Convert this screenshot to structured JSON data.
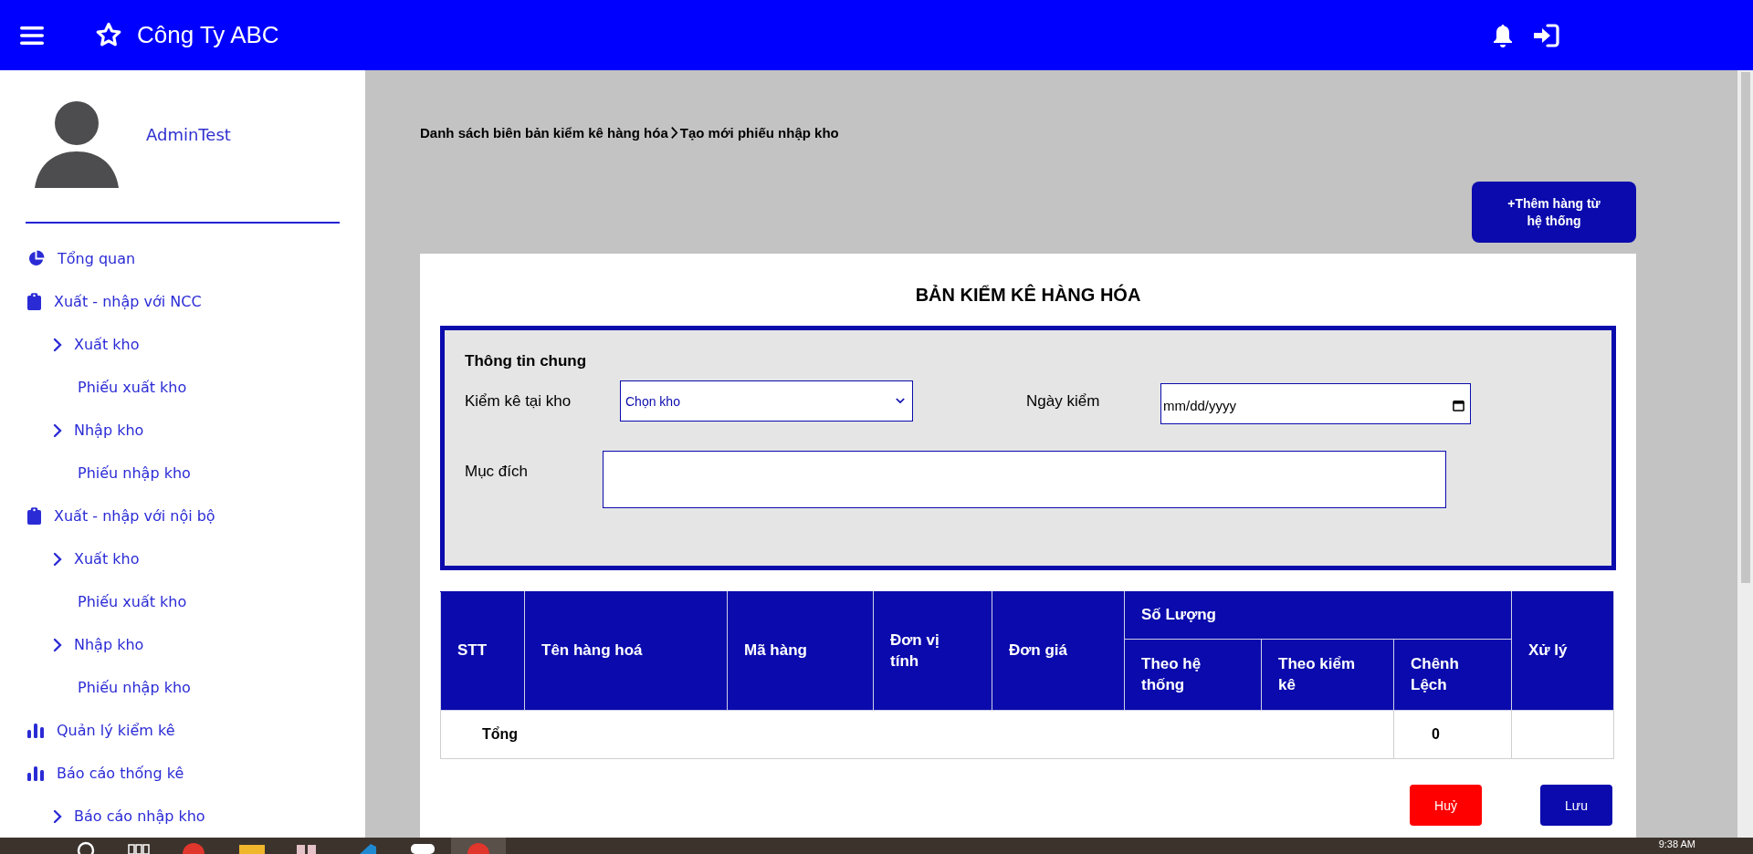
{
  "header": {
    "title": "Công Ty ABC"
  },
  "user": {
    "name": "AdminTest"
  },
  "sidebar": {
    "items": [
      {
        "label": "Tổng quan",
        "kind": "pie"
      },
      {
        "label": "Xuất - nhập với NCC",
        "kind": "clipboard",
        "children": [
          {
            "label": "Xuất kho",
            "kind": "chevron",
            "children": [
              {
                "label": "Phiếu xuất kho"
              }
            ]
          },
          {
            "label": "Nhập kho",
            "kind": "chevron",
            "children": [
              {
                "label": "Phiếu nhập kho"
              }
            ]
          }
        ]
      },
      {
        "label": "Xuất - nhập với nội bộ",
        "kind": "clipboard",
        "children": [
          {
            "label": "Xuất kho",
            "kind": "chevron",
            "children": [
              {
                "label": "Phiếu xuất kho"
              }
            ]
          },
          {
            "label": "Nhập kho",
            "kind": "chevron",
            "children": [
              {
                "label": "Phiếu nhập kho"
              }
            ]
          }
        ]
      },
      {
        "label": "Quản lý kiểm kê",
        "kind": "bars"
      },
      {
        "label": "Báo cáo thống kê",
        "kind": "bars",
        "children": [
          {
            "label": "Báo cáo nhập kho",
            "kind": "chevron"
          }
        ]
      }
    ]
  },
  "breadcrumb": [
    {
      "label": "Danh sách biên bản kiểm kê hàng hóa"
    },
    {
      "label": "Tạo mới phiếu nhập kho"
    }
  ],
  "add_button": "+Thêm hàng từ hệ thống",
  "form": {
    "title": "BẢN KIỂM KÊ HÀNG HÓA",
    "section": "Thông tin chung",
    "warehouse": {
      "label": "Kiểm kê tại kho",
      "value": "Chọn kho"
    },
    "date": {
      "label": "Ngày kiểm",
      "placeholder": "mm/dd/yyyy"
    },
    "purpose": {
      "label": "Mục đích"
    }
  },
  "table": {
    "columns": [
      {
        "label": "STT"
      },
      {
        "label": "Tên hàng hoá"
      },
      {
        "label": "Mã hàng"
      },
      {
        "label": "Đơn vị tính"
      },
      {
        "label": "Đơn giá"
      },
      {
        "label": "Số Lượng",
        "children": [
          {
            "label": "Theo hệ thống"
          },
          {
            "label": "Theo kiểm kê"
          },
          {
            "label": "Chênh Lệch"
          }
        ]
      },
      {
        "label": "Xử lý"
      }
    ],
    "footer": {
      "label": "Tổng",
      "total": "0"
    }
  },
  "buttons": [
    {
      "label": "Huỷ",
      "kind": "cancel"
    },
    {
      "label": "Lưu",
      "kind": "save"
    }
  ],
  "taskbar": {
    "clock": "9:38 AM"
  }
}
